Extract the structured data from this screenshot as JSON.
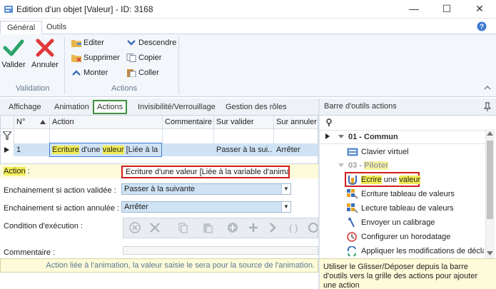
{
  "window": {
    "title": "Edition d'un objet [Valeur] - ID: 3168",
    "minimize": "—",
    "maximize": "☐",
    "close": "✕"
  },
  "ribbon": {
    "tabs": [
      "Général",
      "Outils"
    ],
    "help": "?",
    "validate_label": "Valider",
    "cancel_label": "Annuler",
    "validation_group": "Validation",
    "actions_group": "Actions",
    "edit": "Editer",
    "delete": "Supprimer",
    "move_up": "Monter",
    "move_down": "Descendre",
    "copy": "Copier",
    "paste": "Coller"
  },
  "subtabs": [
    "Affichage",
    "Animation",
    "Actions",
    "Invisibilité/Verrouillage",
    "Gestion des rôles"
  ],
  "grid": {
    "headers": [
      "N°",
      "Action",
      "Commentaire",
      "Sur valider",
      "Sur annuler"
    ],
    "row": {
      "n": "1",
      "action": "Ecriture d'une valeur [Liée à la",
      "comment": "",
      "on_validate": "Passer à la sui...",
      "on_cancel": "Arrêter"
    }
  },
  "form": {
    "action_label": "Action",
    "action_colon": ":",
    "action_value": "Ecriture d'une valeur [Liée à la variable d'animation]",
    "chain_valid_label": "Enchainement si action validée :",
    "chain_valid_value": "Passer à la suivante",
    "chain_cancel_label": "Enchainement si action annulée :",
    "chain_cancel_value": "Arrêter",
    "condition_label": "Condition d'exécution :",
    "comment_label": "Commentaire :"
  },
  "status": "Action liée à l'animation, la valeur saisie le sera pour la source de l'animation.",
  "right_panel": {
    "title": "Barre d'outils actions",
    "pin": "⊕",
    "groups": [
      {
        "label": "01 - Commun",
        "prefix": "01 - ",
        "name": "Commun"
      },
      {
        "label": "03 - Piloter",
        "prefix": "03 - ",
        "name": "Piloter"
      }
    ],
    "items_common": [
      "Clavier virtuel"
    ],
    "items_pilot": [
      "Ecrire une valeur",
      "Ecriture tableau de valeurs",
      "Lecture tableau de valeurs",
      "Envoyer un calibrage",
      "Configurer un horodatage",
      "Appliquer les modifications de déclar"
    ],
    "hint": "Utiliser le Glisser/Déposer depuis la barre d'outils vers la grille des actions pour ajouter une action"
  },
  "colors": {
    "accent_green": "#3f8f3f",
    "highlight_yellow": "#f3ee55",
    "red_box": "#d21e1e",
    "selection_blue": "#cfe3f5"
  }
}
